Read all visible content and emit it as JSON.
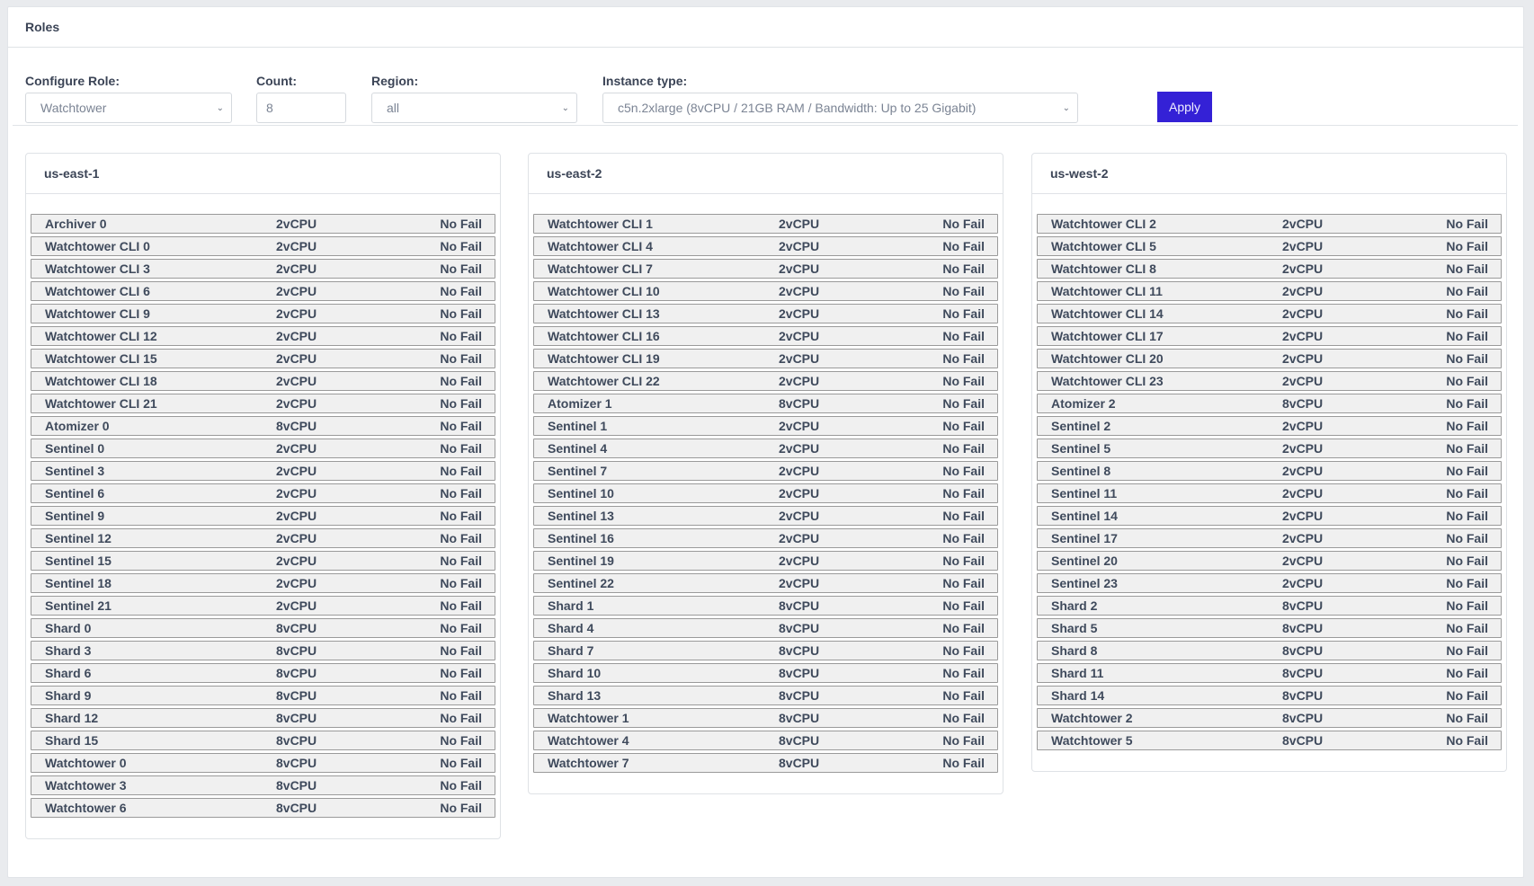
{
  "card": {
    "title": "Roles"
  },
  "form": {
    "role": {
      "label": "Configure Role:",
      "value": "Watchtower"
    },
    "count": {
      "label": "Count:",
      "value": "8"
    },
    "region": {
      "label": "Region:",
      "value": "all"
    },
    "instance": {
      "label": "Instance type:",
      "value": "c5n.2xlarge (8vCPU / 21GB RAM / Bandwidth: Up to 25 Gigabit)"
    },
    "apply_label": "Apply"
  },
  "colors": {
    "accent": "#3421d6",
    "row_bg": "#f0f0f0",
    "row_border": "#9a9a9a"
  },
  "regions": [
    {
      "name": "us-east-1",
      "rows": [
        {
          "name": "Archiver 0",
          "cpu": "2vCPU",
          "status": "No Fail"
        },
        {
          "name": "Watchtower CLI 0",
          "cpu": "2vCPU",
          "status": "No Fail"
        },
        {
          "name": "Watchtower CLI 3",
          "cpu": "2vCPU",
          "status": "No Fail"
        },
        {
          "name": "Watchtower CLI 6",
          "cpu": "2vCPU",
          "status": "No Fail"
        },
        {
          "name": "Watchtower CLI 9",
          "cpu": "2vCPU",
          "status": "No Fail"
        },
        {
          "name": "Watchtower CLI 12",
          "cpu": "2vCPU",
          "status": "No Fail"
        },
        {
          "name": "Watchtower CLI 15",
          "cpu": "2vCPU",
          "status": "No Fail"
        },
        {
          "name": "Watchtower CLI 18",
          "cpu": "2vCPU",
          "status": "No Fail"
        },
        {
          "name": "Watchtower CLI 21",
          "cpu": "2vCPU",
          "status": "No Fail"
        },
        {
          "name": "Atomizer 0",
          "cpu": "8vCPU",
          "status": "No Fail"
        },
        {
          "name": "Sentinel 0",
          "cpu": "2vCPU",
          "status": "No Fail"
        },
        {
          "name": "Sentinel 3",
          "cpu": "2vCPU",
          "status": "No Fail"
        },
        {
          "name": "Sentinel 6",
          "cpu": "2vCPU",
          "status": "No Fail"
        },
        {
          "name": "Sentinel 9",
          "cpu": "2vCPU",
          "status": "No Fail"
        },
        {
          "name": "Sentinel 12",
          "cpu": "2vCPU",
          "status": "No Fail"
        },
        {
          "name": "Sentinel 15",
          "cpu": "2vCPU",
          "status": "No Fail"
        },
        {
          "name": "Sentinel 18",
          "cpu": "2vCPU",
          "status": "No Fail"
        },
        {
          "name": "Sentinel 21",
          "cpu": "2vCPU",
          "status": "No Fail"
        },
        {
          "name": "Shard 0",
          "cpu": "8vCPU",
          "status": "No Fail"
        },
        {
          "name": "Shard 3",
          "cpu": "8vCPU",
          "status": "No Fail"
        },
        {
          "name": "Shard 6",
          "cpu": "8vCPU",
          "status": "No Fail"
        },
        {
          "name": "Shard 9",
          "cpu": "8vCPU",
          "status": "No Fail"
        },
        {
          "name": "Shard 12",
          "cpu": "8vCPU",
          "status": "No Fail"
        },
        {
          "name": "Shard 15",
          "cpu": "8vCPU",
          "status": "No Fail"
        },
        {
          "name": "Watchtower 0",
          "cpu": "8vCPU",
          "status": "No Fail"
        },
        {
          "name": "Watchtower 3",
          "cpu": "8vCPU",
          "status": "No Fail"
        },
        {
          "name": "Watchtower 6",
          "cpu": "8vCPU",
          "status": "No Fail"
        }
      ]
    },
    {
      "name": "us-east-2",
      "rows": [
        {
          "name": "Watchtower CLI 1",
          "cpu": "2vCPU",
          "status": "No Fail"
        },
        {
          "name": "Watchtower CLI 4",
          "cpu": "2vCPU",
          "status": "No Fail"
        },
        {
          "name": "Watchtower CLI 7",
          "cpu": "2vCPU",
          "status": "No Fail"
        },
        {
          "name": "Watchtower CLI 10",
          "cpu": "2vCPU",
          "status": "No Fail"
        },
        {
          "name": "Watchtower CLI 13",
          "cpu": "2vCPU",
          "status": "No Fail"
        },
        {
          "name": "Watchtower CLI 16",
          "cpu": "2vCPU",
          "status": "No Fail"
        },
        {
          "name": "Watchtower CLI 19",
          "cpu": "2vCPU",
          "status": "No Fail"
        },
        {
          "name": "Watchtower CLI 22",
          "cpu": "2vCPU",
          "status": "No Fail"
        },
        {
          "name": "Atomizer 1",
          "cpu": "8vCPU",
          "status": "No Fail"
        },
        {
          "name": "Sentinel 1",
          "cpu": "2vCPU",
          "status": "No Fail"
        },
        {
          "name": "Sentinel 4",
          "cpu": "2vCPU",
          "status": "No Fail"
        },
        {
          "name": "Sentinel 7",
          "cpu": "2vCPU",
          "status": "No Fail"
        },
        {
          "name": "Sentinel 10",
          "cpu": "2vCPU",
          "status": "No Fail"
        },
        {
          "name": "Sentinel 13",
          "cpu": "2vCPU",
          "status": "No Fail"
        },
        {
          "name": "Sentinel 16",
          "cpu": "2vCPU",
          "status": "No Fail"
        },
        {
          "name": "Sentinel 19",
          "cpu": "2vCPU",
          "status": "No Fail"
        },
        {
          "name": "Sentinel 22",
          "cpu": "2vCPU",
          "status": "No Fail"
        },
        {
          "name": "Shard 1",
          "cpu": "8vCPU",
          "status": "No Fail"
        },
        {
          "name": "Shard 4",
          "cpu": "8vCPU",
          "status": "No Fail"
        },
        {
          "name": "Shard 7",
          "cpu": "8vCPU",
          "status": "No Fail"
        },
        {
          "name": "Shard 10",
          "cpu": "8vCPU",
          "status": "No Fail"
        },
        {
          "name": "Shard 13",
          "cpu": "8vCPU",
          "status": "No Fail"
        },
        {
          "name": "Watchtower 1",
          "cpu": "8vCPU",
          "status": "No Fail"
        },
        {
          "name": "Watchtower 4",
          "cpu": "8vCPU",
          "status": "No Fail"
        },
        {
          "name": "Watchtower 7",
          "cpu": "8vCPU",
          "status": "No Fail"
        }
      ]
    },
    {
      "name": "us-west-2",
      "rows": [
        {
          "name": "Watchtower CLI 2",
          "cpu": "2vCPU",
          "status": "No Fail"
        },
        {
          "name": "Watchtower CLI 5",
          "cpu": "2vCPU",
          "status": "No Fail"
        },
        {
          "name": "Watchtower CLI 8",
          "cpu": "2vCPU",
          "status": "No Fail"
        },
        {
          "name": "Watchtower CLI 11",
          "cpu": "2vCPU",
          "status": "No Fail"
        },
        {
          "name": "Watchtower CLI 14",
          "cpu": "2vCPU",
          "status": "No Fail"
        },
        {
          "name": "Watchtower CLI 17",
          "cpu": "2vCPU",
          "status": "No Fail"
        },
        {
          "name": "Watchtower CLI 20",
          "cpu": "2vCPU",
          "status": "No Fail"
        },
        {
          "name": "Watchtower CLI 23",
          "cpu": "2vCPU",
          "status": "No Fail"
        },
        {
          "name": "Atomizer 2",
          "cpu": "8vCPU",
          "status": "No Fail"
        },
        {
          "name": "Sentinel 2",
          "cpu": "2vCPU",
          "status": "No Fail"
        },
        {
          "name": "Sentinel 5",
          "cpu": "2vCPU",
          "status": "No Fail"
        },
        {
          "name": "Sentinel 8",
          "cpu": "2vCPU",
          "status": "No Fail"
        },
        {
          "name": "Sentinel 11",
          "cpu": "2vCPU",
          "status": "No Fail"
        },
        {
          "name": "Sentinel 14",
          "cpu": "2vCPU",
          "status": "No Fail"
        },
        {
          "name": "Sentinel 17",
          "cpu": "2vCPU",
          "status": "No Fail"
        },
        {
          "name": "Sentinel 20",
          "cpu": "2vCPU",
          "status": "No Fail"
        },
        {
          "name": "Sentinel 23",
          "cpu": "2vCPU",
          "status": "No Fail"
        },
        {
          "name": "Shard 2",
          "cpu": "8vCPU",
          "status": "No Fail"
        },
        {
          "name": "Shard 5",
          "cpu": "8vCPU",
          "status": "No Fail"
        },
        {
          "name": "Shard 8",
          "cpu": "8vCPU",
          "status": "No Fail"
        },
        {
          "name": "Shard 11",
          "cpu": "8vCPU",
          "status": "No Fail"
        },
        {
          "name": "Shard 14",
          "cpu": "8vCPU",
          "status": "No Fail"
        },
        {
          "name": "Watchtower 2",
          "cpu": "8vCPU",
          "status": "No Fail"
        },
        {
          "name": "Watchtower 5",
          "cpu": "8vCPU",
          "status": "No Fail"
        }
      ]
    }
  ]
}
